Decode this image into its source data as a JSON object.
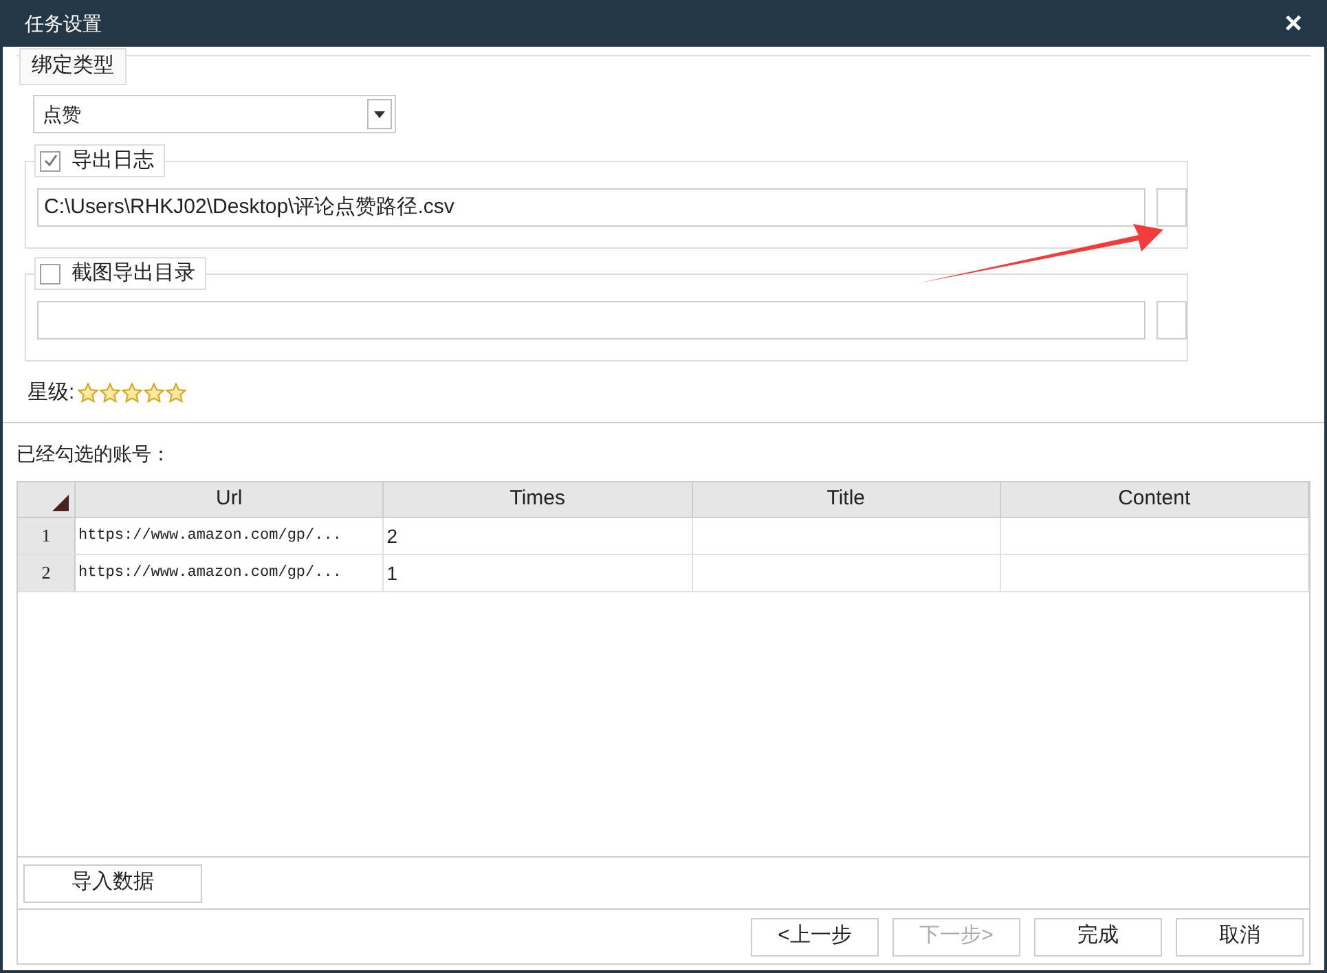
{
  "window": {
    "title": "任务设置",
    "close": "×"
  },
  "binding": {
    "legend": "绑定类型",
    "value": "点赞"
  },
  "export_log": {
    "label": "导出日志",
    "checked": true,
    "path": "C:\\Users\\RHKJ02\\Desktop\\评论点赞路径.csv"
  },
  "screenshot_dir": {
    "label": "截图导出目录",
    "checked": false
  },
  "rating": {
    "label": "星级:",
    "stars": 5
  },
  "accounts_label": "已经勾选的账号：",
  "table": {
    "columns": [
      "Url",
      "Times",
      "Title",
      "Content"
    ],
    "rows": [
      {
        "index": "1",
        "cells": [
          "https://www.amazon.com/gp/...",
          "2",
          "",
          ""
        ]
      },
      {
        "index": "2",
        "cells": [
          "https://www.amazon.com/gp/...",
          "1",
          "",
          ""
        ]
      }
    ]
  },
  "import_button": "导入数据",
  "buttons": [
    {
      "label": "<上一步",
      "disabled": false
    },
    {
      "label": "下一步>",
      "disabled": true
    },
    {
      "label": "完成",
      "disabled": false
    },
    {
      "label": "取消",
      "disabled": false
    }
  ]
}
